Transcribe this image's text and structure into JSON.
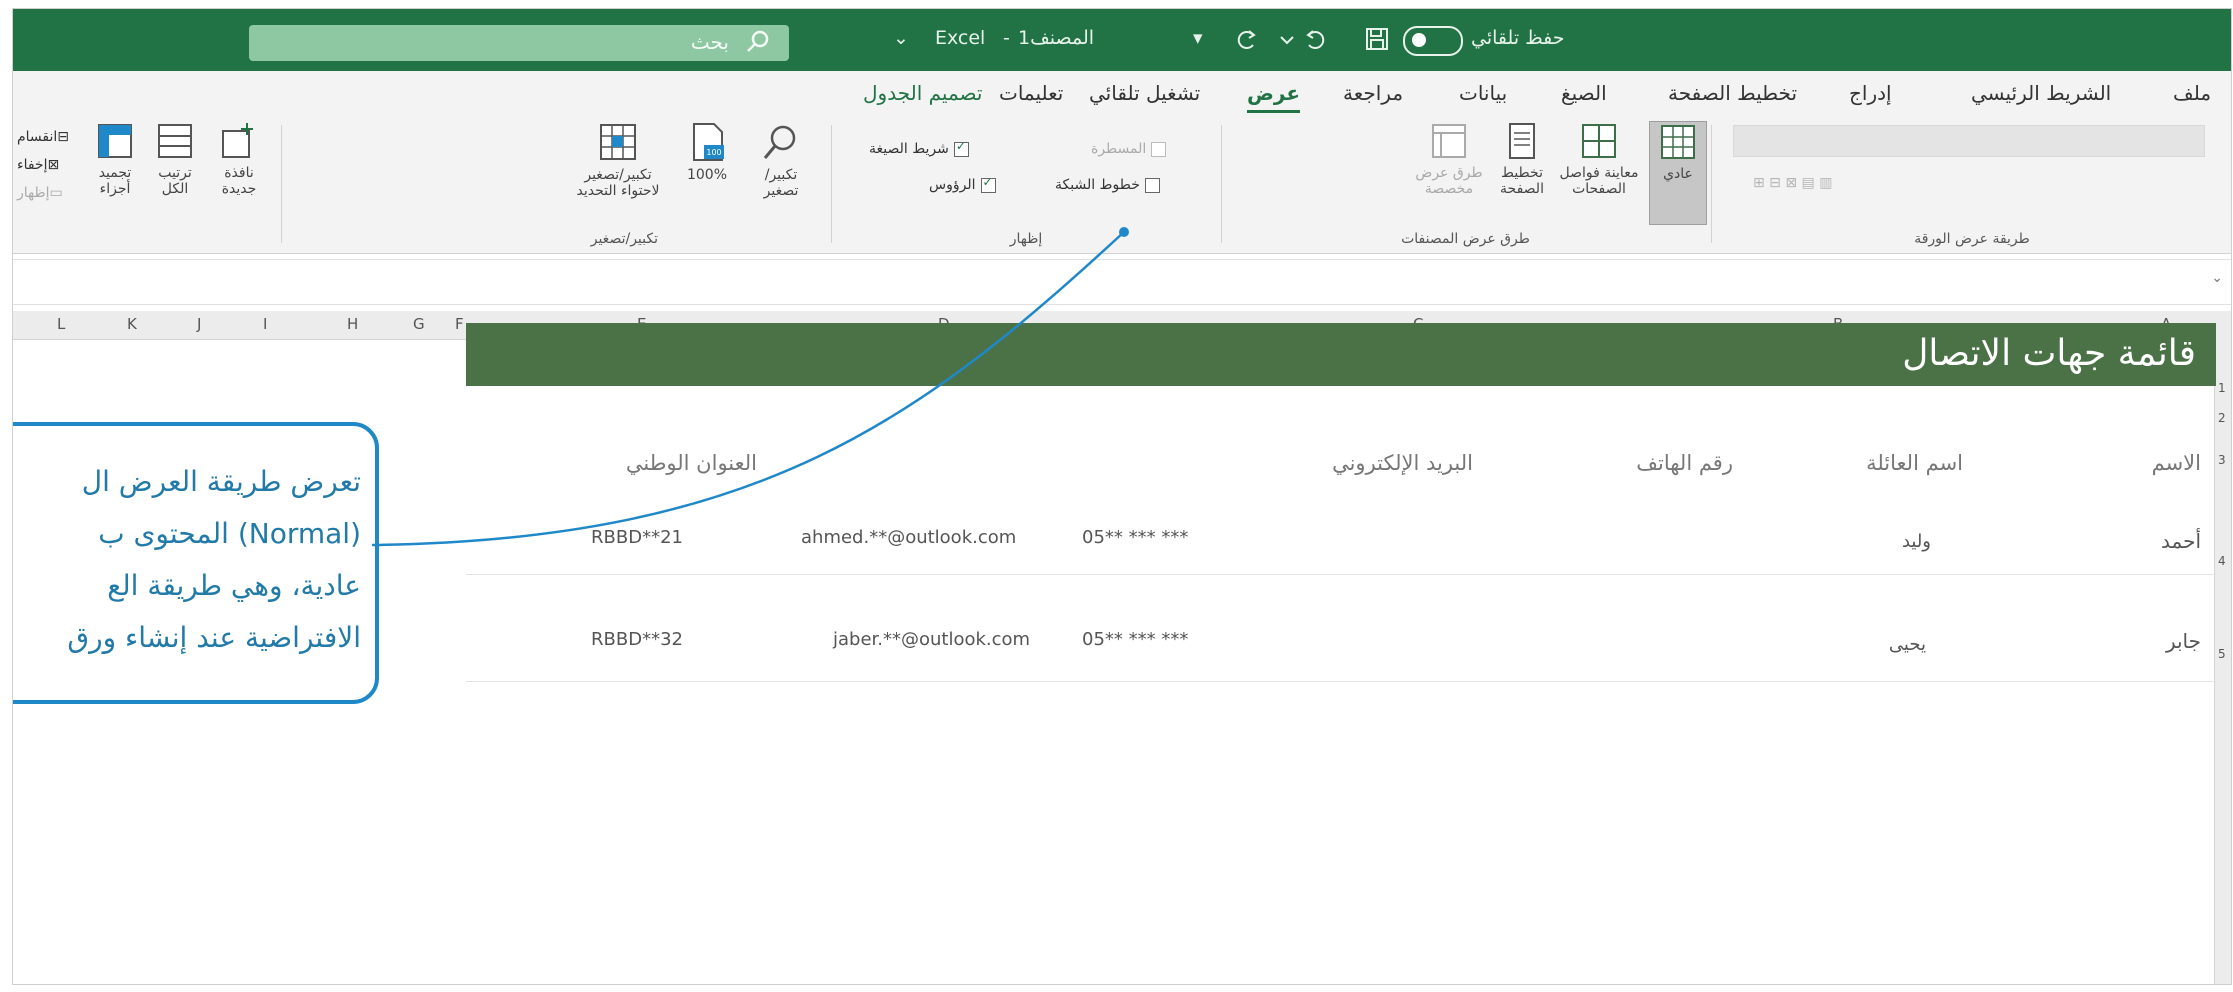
{
  "titlebar": {
    "autosave": "حفظ تلقائي",
    "app": "Excel",
    "doc": "المصنف1",
    "search": "بحث"
  },
  "tabs": [
    "ملف",
    "الشريط الرئيسي",
    "إدراج",
    "تخطيط الصفحة",
    "الصيغ",
    "بيانات",
    "مراجعة",
    "عرض",
    "تشغيل تلقائي",
    "تعليمات",
    "تصميم الجدول"
  ],
  "active_tab": "عرض",
  "ribbon": {
    "sheet_view_label": "طريقة عرض الورقة",
    "workbook_views_label": "طرق عرض المصنفات",
    "show_label": "إظهار",
    "zoom_label": "تكبير/تصغير",
    "normal": "عادي",
    "page_break_preview": "معاينة فواصل الصفحات",
    "page_layout": "تخطيط الصفحة",
    "custom_views": "طرق عرض مخصصة",
    "ruler": "المسطرة",
    "gridlines": "خطوط الشبكة",
    "formula_bar": "شريط الصيغة",
    "headings": "الرؤوس",
    "zoom": "تكبير/ تصغير",
    "zoom_100": "100%",
    "zoom_to_selection": "تكبير/تصغير لاحتواء التحديد",
    "new_window": "نافذة جديدة",
    "arrange_all": "ترتيب الكل",
    "freeze_panes": "تجميد أجزاء",
    "split": "انقسام",
    "hide": "إخفاء",
    "unhide": "إظهار"
  },
  "columns": [
    "A",
    "B",
    "C",
    "D",
    "E",
    "F",
    "G",
    "H",
    "I",
    "J",
    "K",
    "L"
  ],
  "rows": [
    "1",
    "2",
    "3",
    "4",
    "5"
  ],
  "sheet": {
    "title": "قائمة جهات الاتصال",
    "headers": [
      "الاسم",
      "اسم العائلة",
      "رقم الهاتف",
      "البريد الإلكتروني",
      "العنوان الوطني"
    ],
    "data": [
      [
        "أحمد",
        "وليد",
        "05** *** ***",
        "ahmed.**@outlook.com",
        "RBBD**21"
      ],
      [
        "جابر",
        "يحيى",
        "05** *** ***",
        "jaber.**@outlook.com",
        "RBBD**32"
      ]
    ]
  },
  "callout": {
    "lines": [
      "تعرض طريقة العرض ال",
      "(Normal) المحتوى ب",
      "عادية، وهي طريقة الع",
      "الافتراضية عند إنشاء ورق"
    ]
  },
  "colors": {
    "excel_green": "#217346",
    "title_band": "#4a7246",
    "callout_blue": "#1f88c9"
  }
}
